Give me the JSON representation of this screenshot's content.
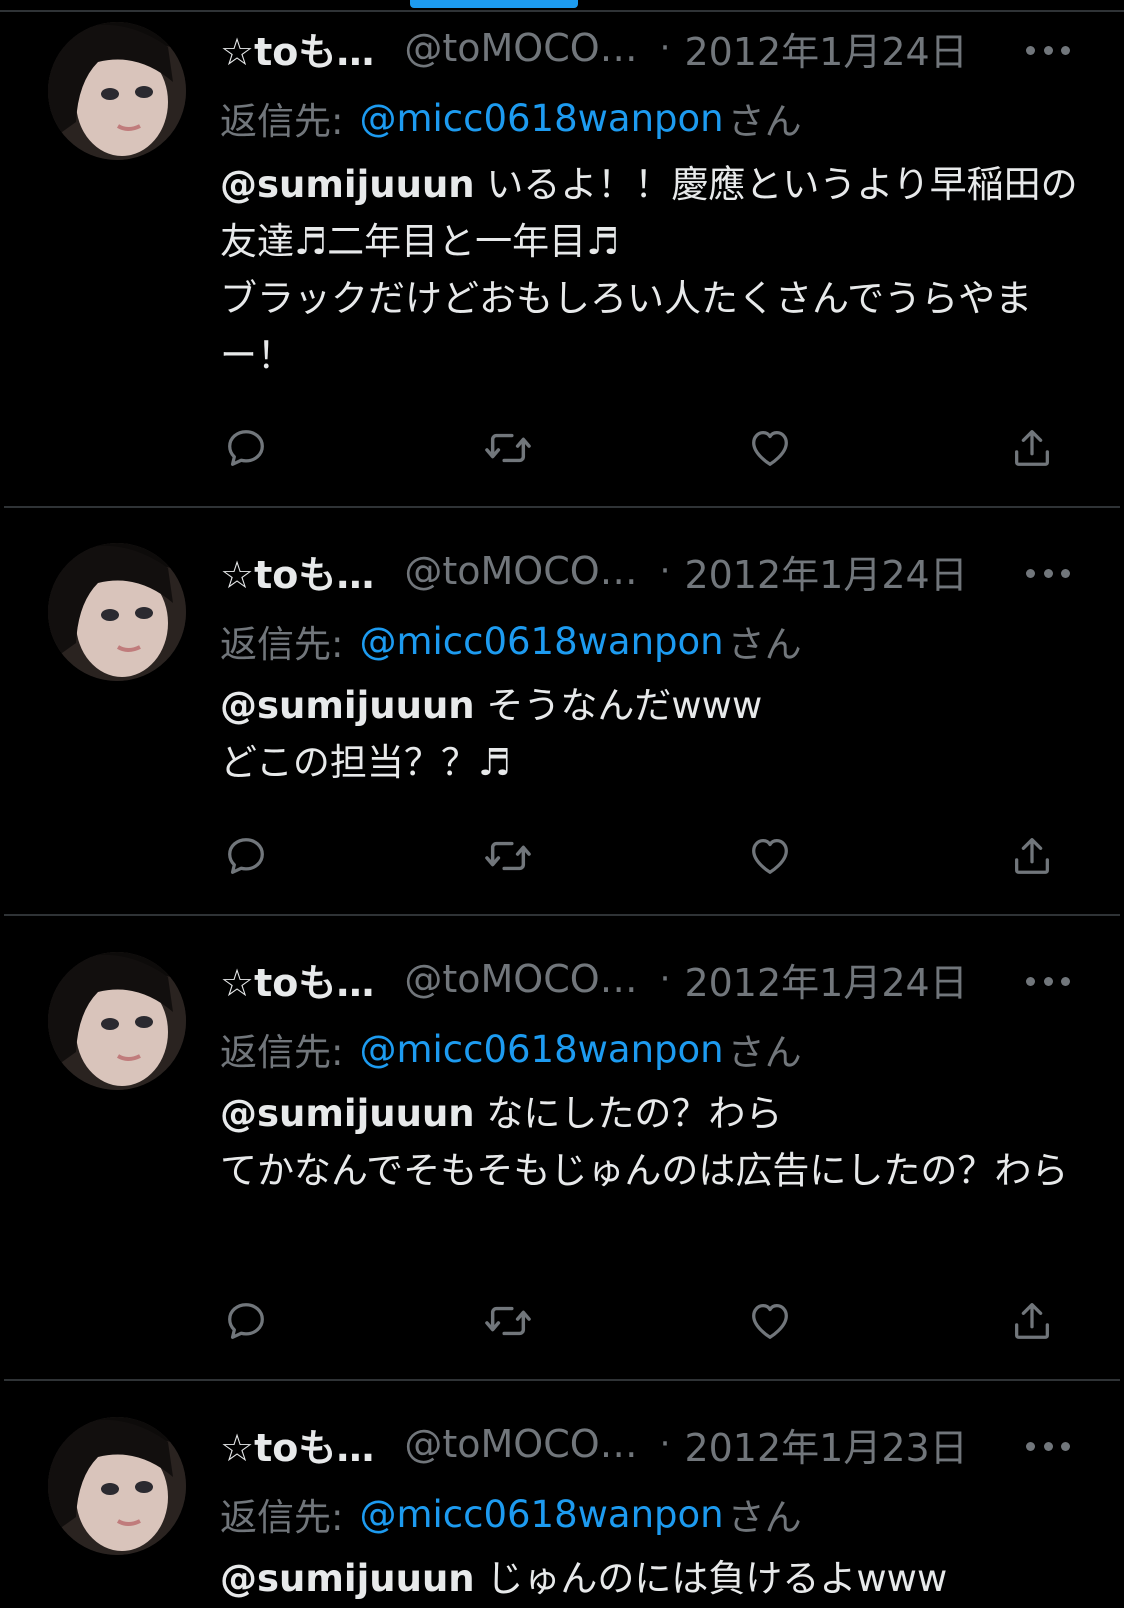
{
  "colors": {
    "background": "#000000",
    "text": "#e7e9ea",
    "secondary": "#71767b",
    "link": "#1d9bf0",
    "divider": "#2f3336"
  },
  "icons": {
    "more": "more-horizontal-icon",
    "reply": "reply-icon",
    "retweet": "retweet-icon",
    "like": "heart-icon",
    "share": "share-icon"
  },
  "tweets": [
    {
      "display_name": "☆toも…",
      "handle": "@toMOCO…",
      "separator": "·",
      "date": "2012年1月24日",
      "reply_prefix": "返信先:",
      "reply_handle": "@micc0618wanpon",
      "reply_suffix": "さん",
      "mention": "@sumijuuun",
      "text": " いるよ！！慶應というより早稲田の友達♬二年目と一年目♬\nブラックだけどおもしろい人たくさんでうらやまー！"
    },
    {
      "display_name": "☆toも…",
      "handle": "@toMOCO…",
      "separator": "·",
      "date": "2012年1月24日",
      "reply_prefix": "返信先:",
      "reply_handle": "@micc0618wanpon",
      "reply_suffix": "さん",
      "mention": "@sumijuuun",
      "text": " そうなんだwww\nどこの担当？？♬"
    },
    {
      "display_name": "☆toも…",
      "handle": "@toMOCO…",
      "separator": "·",
      "date": "2012年1月24日",
      "reply_prefix": "返信先:",
      "reply_handle": "@micc0618wanpon",
      "reply_suffix": "さん",
      "mention": "@sumijuuun",
      "text": " なにしたの？わら\nてかなんでそもそもじゅんのは広告にしたの？わら"
    },
    {
      "display_name": "☆toも…",
      "handle": "@toMOCO…",
      "separator": "·",
      "date": "2012年1月23日",
      "reply_prefix": "返信先:",
      "reply_handle": "@micc0618wanpon",
      "reply_suffix": "さん",
      "mention": "@sumijuuun",
      "text": " じゅんのには負けるよwww"
    }
  ]
}
